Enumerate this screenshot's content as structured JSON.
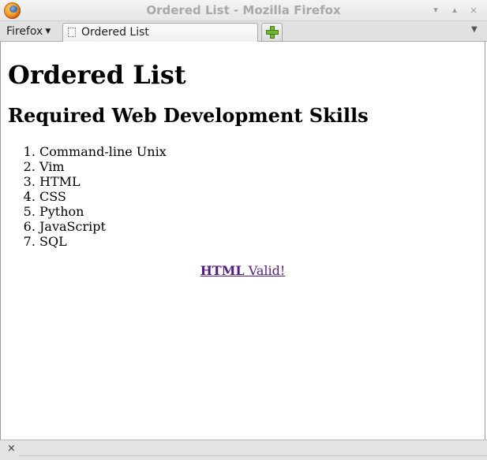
{
  "window": {
    "title": "Ordered List - Mozilla Firefox",
    "controls": {
      "minimize": "▾",
      "maximize": "▴",
      "close": "×"
    }
  },
  "tabbar": {
    "menu_label": "Firefox",
    "menu_arrow": "▼",
    "tabs": [
      {
        "label": "Ordered List"
      }
    ],
    "new_tab_icon": "plus-icon",
    "tab_list_arrow": "▼"
  },
  "page": {
    "heading": "Ordered List",
    "subheading": "Required Web Development Skills",
    "skills": [
      "Command-line Unix",
      "Vim",
      "HTML",
      "CSS",
      "Python",
      "JavaScript",
      "SQL"
    ],
    "validator_link": {
      "bold": "HTML",
      "rest": " Valid!"
    },
    "link_color": "#551a8b"
  },
  "statusbar": {
    "close": "×"
  }
}
